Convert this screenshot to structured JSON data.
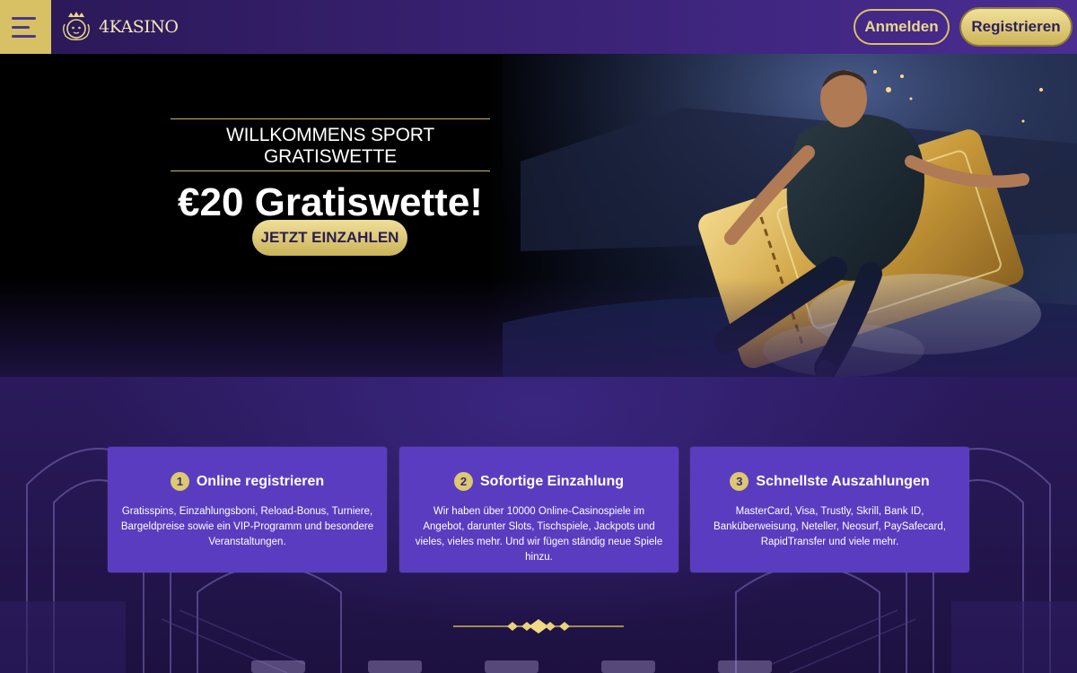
{
  "header": {
    "brand": "4KASINO",
    "login_label": "Anmelden",
    "register_label": "Registrieren",
    "menu_icon": "hamburger-menu-icon",
    "logo_icon": "crowned-lion-logo"
  },
  "hero": {
    "subtitle": "WILLKOMMENS SPORT GRATISWETTE",
    "title": "€20 Gratiswette!",
    "cta_label": "JETZT EINZAHLEN"
  },
  "steps": [
    {
      "number": "1",
      "title": "Online registrieren",
      "text": "Gratisspins, Einzahlungsboni, Reload-Bonus, Turniere, Bargeldpreise sowie ein VIP-Programm und besondere Veranstaltungen."
    },
    {
      "number": "2",
      "title": "Sofortige Einzahlung",
      "text": "Wir haben über 10000 Online-Casinospiele im Angebot, darunter Slots, Tischspiele, Jackpots und vieles, vieles mehr. Und wir fügen ständig neue Spiele hinzu."
    },
    {
      "number": "3",
      "title": "Schnellste Auszahlungen",
      "text": "MasterCard, Visa, Trustly, Skrill, Bank ID, Banküberweisung, Neteller, Neosurf, PaySafecard, RapidTransfer und viele mehr."
    }
  ],
  "colors": {
    "accent_gold": "#d8c165",
    "header_purple": "#3b2377",
    "card_purple": "#5a3cc0"
  }
}
